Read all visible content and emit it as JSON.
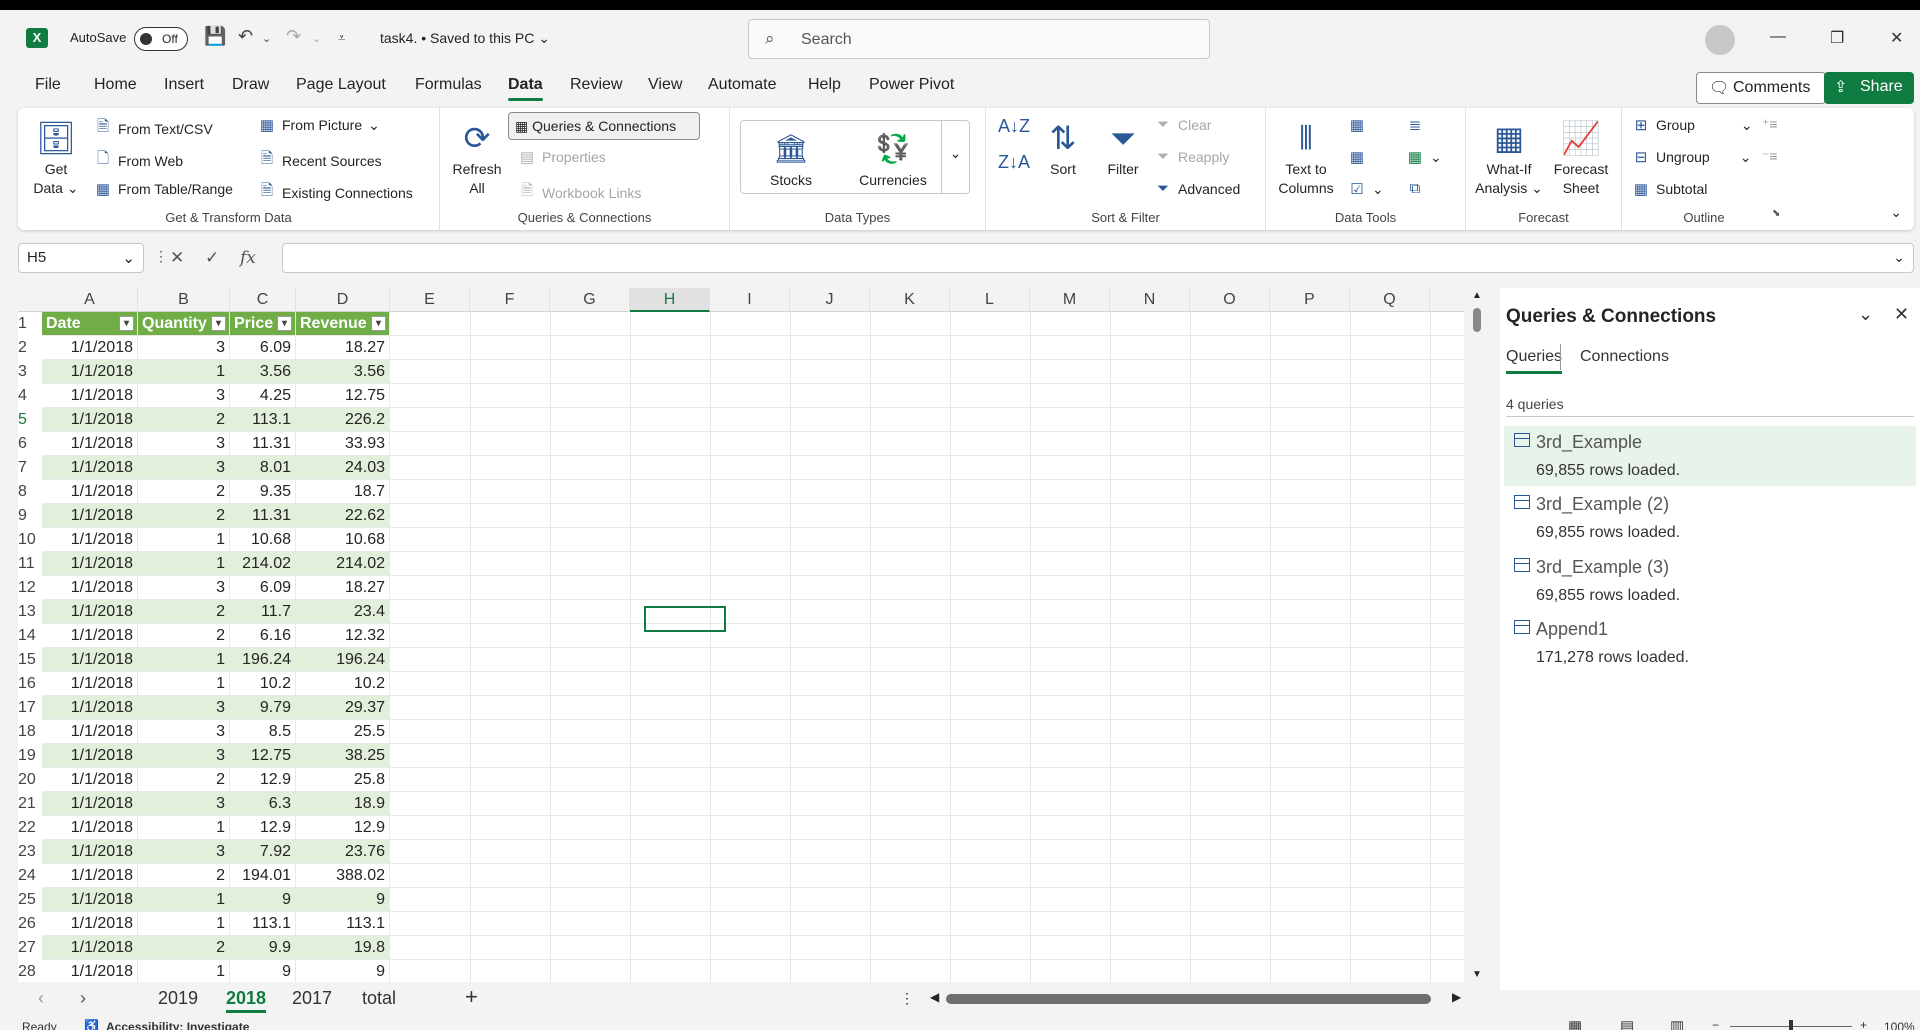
{
  "titlebar": {
    "autosave_label": "AutoSave",
    "autosave_state": "Off",
    "document_title": "task4. • Saved to this PC ⌄",
    "search_placeholder": "Search"
  },
  "menu": [
    "File",
    "Home",
    "Insert",
    "Draw",
    "Page Layout",
    "Formulas",
    "Data",
    "Review",
    "View",
    "Automate",
    "Help",
    "Power Pivot"
  ],
  "menu_active": "Data",
  "top_buttons": {
    "comments": "Comments",
    "share": "Share"
  },
  "ribbon": {
    "get_transform": {
      "label": "Get & Transform Data",
      "get_data": "Get Data",
      "items": [
        "From Text/CSV",
        "From Web",
        "From Table/Range",
        "From Picture",
        "Recent Sources",
        "Existing Connections"
      ]
    },
    "queries": {
      "label": "Queries & Connections",
      "refresh": "Refresh All",
      "qc_button": "Queries & Connections",
      "properties": "Properties",
      "workbook_links": "Workbook Links"
    },
    "data_types": {
      "label": "Data Types",
      "stocks": "Stocks",
      "currencies": "Currencies"
    },
    "sort_filter": {
      "label": "Sort & Filter",
      "sort": "Sort",
      "filter": "Filter",
      "clear": "Clear",
      "reapply": "Reapply",
      "advanced": "Advanced"
    },
    "data_tools": {
      "label": "Data Tools",
      "text_to_columns": "Text to Columns"
    },
    "forecast": {
      "label": "Forecast",
      "what_if": "What-If Analysis",
      "forecast_sheet": "Forecast Sheet"
    },
    "outline": {
      "label": "Outline",
      "group": "Group",
      "ungroup": "Ungroup",
      "subtotal": "Subtotal"
    }
  },
  "formula_bar": {
    "name_box": "H5",
    "fx": "fx",
    "value": ""
  },
  "grid": {
    "columns": [
      "A",
      "B",
      "C",
      "D",
      "E",
      "F",
      "G",
      "H",
      "I",
      "J",
      "K",
      "L",
      "M",
      "N",
      "O",
      "P",
      "Q"
    ],
    "selected_column": "H",
    "selected_row": 5,
    "header": [
      "Date",
      "Quantity",
      "Price",
      "Revenue"
    ],
    "rows": [
      [
        "1/1/2018",
        "3",
        "6.09",
        "18.27"
      ],
      [
        "1/1/2018",
        "1",
        "3.56",
        "3.56"
      ],
      [
        "1/1/2018",
        "3",
        "4.25",
        "12.75"
      ],
      [
        "1/1/2018",
        "2",
        "113.1",
        "226.2"
      ],
      [
        "1/1/2018",
        "3",
        "11.31",
        "33.93"
      ],
      [
        "1/1/2018",
        "3",
        "8.01",
        "24.03"
      ],
      [
        "1/1/2018",
        "2",
        "9.35",
        "18.7"
      ],
      [
        "1/1/2018",
        "2",
        "11.31",
        "22.62"
      ],
      [
        "1/1/2018",
        "1",
        "10.68",
        "10.68"
      ],
      [
        "1/1/2018",
        "1",
        "214.02",
        "214.02"
      ],
      [
        "1/1/2018",
        "3",
        "6.09",
        "18.27"
      ],
      [
        "1/1/2018",
        "2",
        "11.7",
        "23.4"
      ],
      [
        "1/1/2018",
        "2",
        "6.16",
        "12.32"
      ],
      [
        "1/1/2018",
        "1",
        "196.24",
        "196.24"
      ],
      [
        "1/1/2018",
        "1",
        "10.2",
        "10.2"
      ],
      [
        "1/1/2018",
        "3",
        "9.79",
        "29.37"
      ],
      [
        "1/1/2018",
        "3",
        "8.5",
        "25.5"
      ],
      [
        "1/1/2018",
        "3",
        "12.75",
        "38.25"
      ],
      [
        "1/1/2018",
        "2",
        "12.9",
        "25.8"
      ],
      [
        "1/1/2018",
        "3",
        "6.3",
        "18.9"
      ],
      [
        "1/1/2018",
        "1",
        "12.9",
        "12.9"
      ],
      [
        "1/1/2018",
        "3",
        "7.92",
        "23.76"
      ],
      [
        "1/1/2018",
        "2",
        "194.01",
        "388.02"
      ],
      [
        "1/1/2018",
        "1",
        "9",
        "9"
      ],
      [
        "1/1/2018",
        "1",
        "113.1",
        "113.1"
      ],
      [
        "1/1/2018",
        "2",
        "9.9",
        "19.8"
      ],
      [
        "1/1/2018",
        "1",
        "9",
        "9"
      ]
    ]
  },
  "sheets": [
    "2019",
    "2018",
    "2017",
    "total"
  ],
  "active_sheet": "2018",
  "status": {
    "ready": "Ready",
    "accessibility": "Accessibility: Investigate",
    "zoom": "100%"
  },
  "pane": {
    "title": "Queries & Connections",
    "tabs": [
      "Queries",
      "Connections"
    ],
    "count": "4 queries",
    "queries": [
      {
        "name": "3rd_Example",
        "rows": "69,855 rows loaded."
      },
      {
        "name": "3rd_Example (2)",
        "rows": "69,855 rows loaded."
      },
      {
        "name": "3rd_Example (3)",
        "rows": "69,855 rows loaded."
      },
      {
        "name": "Append1",
        "rows": "171,278 rows loaded."
      }
    ]
  },
  "colors": {
    "accent": "#107c41",
    "table_header": "#70ad47",
    "table_band": "#e2efda"
  }
}
